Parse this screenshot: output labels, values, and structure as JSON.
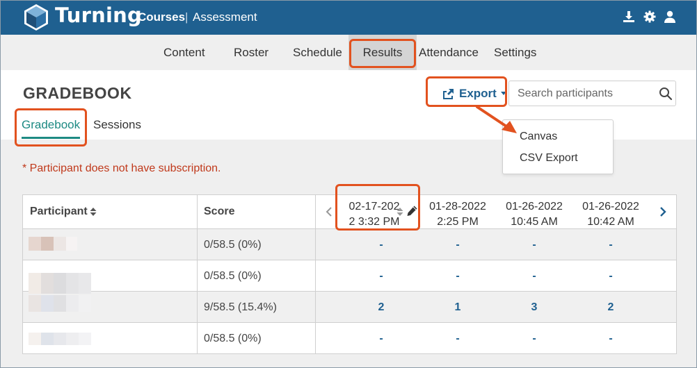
{
  "app": {
    "brand": "Turning"
  },
  "header": {
    "courses": "Courses",
    "separator": "|",
    "course_name": "Assessment"
  },
  "nav": {
    "items": [
      "Content",
      "Roster",
      "Schedule",
      "Results",
      "Attendance",
      "Settings"
    ],
    "active": "Results"
  },
  "page": {
    "title": "GRADEBOOK"
  },
  "subtabs": {
    "items": [
      "Gradebook",
      "Sessions"
    ],
    "active": "Gradebook"
  },
  "export": {
    "label": "Export",
    "menu": [
      "Canvas",
      "CSV Export"
    ]
  },
  "search": {
    "placeholder": "Search participants",
    "value": ""
  },
  "warning": "* Participant does not have subscription.",
  "table": {
    "participant_header": "Participant",
    "score_header": "Score",
    "dates": [
      {
        "line1": "02-17-202",
        "line2": "2 3:32 PM"
      },
      {
        "line1": "01-28-2022",
        "line2": "2:25 PM"
      },
      {
        "line1": "01-26-2022",
        "line2": "10:45 AM"
      },
      {
        "line1": "01-26-2022",
        "line2": "10:42 AM"
      }
    ],
    "rows": [
      {
        "score": "0/58.5 (0%)",
        "values": [
          "-",
          "-",
          "-",
          "-"
        ]
      },
      {
        "score": "0/58.5 (0%)",
        "values": [
          "-",
          "-",
          "-",
          "-"
        ]
      },
      {
        "score": "9/58.5 (15.4%)",
        "values": [
          "2",
          "1",
          "3",
          "2"
        ]
      },
      {
        "score": "0/58.5 (0%)",
        "values": [
          "-",
          "-",
          "-",
          "-"
        ]
      }
    ]
  },
  "colors": {
    "header_blue": "#1f6090",
    "teal": "#1d8a83",
    "warning_red": "#c0391b",
    "annotation": "#e2521f"
  }
}
